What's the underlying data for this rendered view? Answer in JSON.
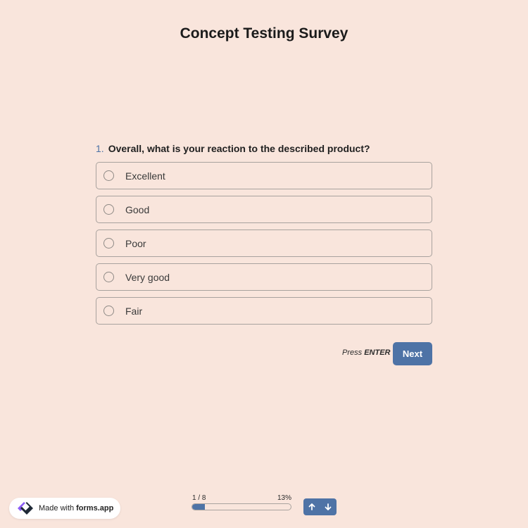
{
  "survey": {
    "title": "Concept Testing Survey"
  },
  "question": {
    "number": "1.",
    "text": "Overall, what is your reaction to the described product?",
    "options": [
      {
        "label": "Excellent"
      },
      {
        "label": "Good"
      },
      {
        "label": "Poor"
      },
      {
        "label": "Very good"
      },
      {
        "label": "Fair"
      }
    ]
  },
  "actions": {
    "press_prefix": "Press",
    "press_key": "ENTER",
    "next_label": "Next"
  },
  "progress": {
    "count": "1 / 8",
    "percent_label": "13%",
    "fraction": 0.13
  },
  "footer": {
    "made_with": "Made with",
    "brand": "forms.app"
  },
  "colors": {
    "background": "#f9e5dc",
    "accent": "#4e73a6"
  },
  "icons": {
    "up": "arrow-up-icon",
    "down": "arrow-down-icon",
    "logo": "forms-app-logo"
  }
}
